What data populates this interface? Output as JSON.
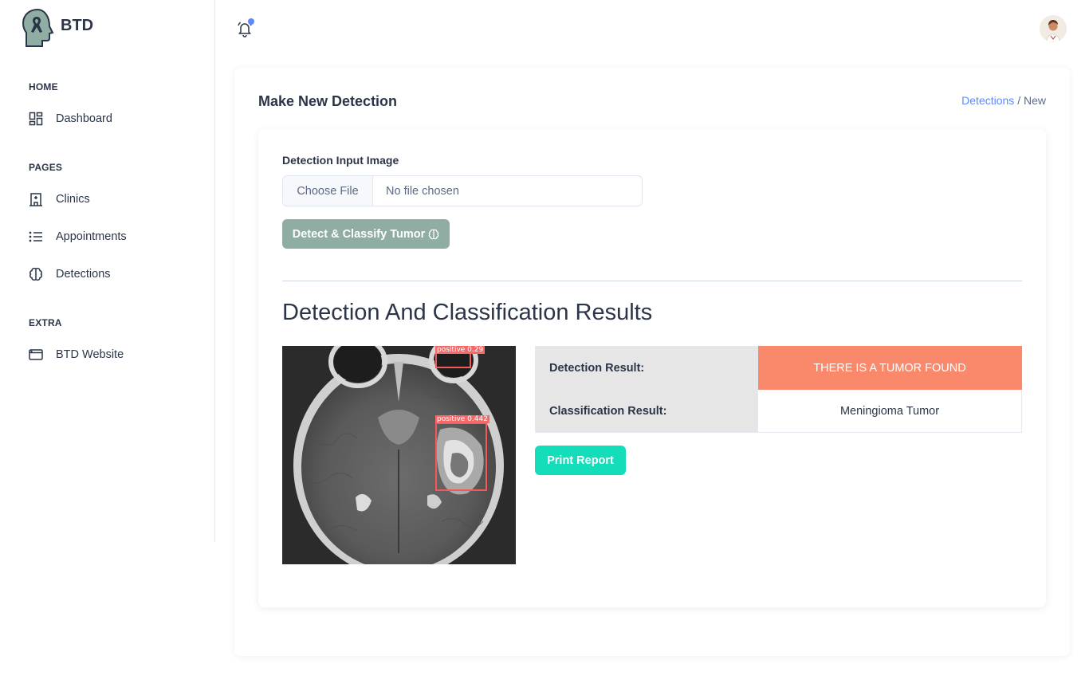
{
  "brand": {
    "name": "BTD",
    "logo_icon": "head-ribbon-logo"
  },
  "sidebar": {
    "sections": [
      {
        "title": "HOME",
        "items": [
          {
            "label": "Dashboard",
            "icon": "dashboard-icon"
          }
        ]
      },
      {
        "title": "PAGES",
        "items": [
          {
            "label": "Clinics",
            "icon": "building-icon"
          },
          {
            "label": "Appointments",
            "icon": "list-icon"
          },
          {
            "label": "Detections",
            "icon": "brain-icon"
          }
        ]
      },
      {
        "title": "EXTRA",
        "items": [
          {
            "label": "BTD Website",
            "icon": "browser-icon"
          }
        ]
      }
    ]
  },
  "header": {
    "notification_icon": "bell-icon",
    "notification_dot_color": "#5d87ff",
    "avatar": "user-avatar"
  },
  "page": {
    "title": "Make New Detection",
    "breadcrumb": {
      "link": "Detections",
      "separator": " / ",
      "current": "New"
    }
  },
  "form": {
    "label": "Detection Input Image",
    "file_button": "Choose File",
    "file_status": "No file chosen",
    "submit_label": "Detect & Classify Tumor",
    "submit_color": "#8fada3"
  },
  "results": {
    "title": "Detection And Classification Results",
    "image": {
      "boxes": [
        {
          "label": "positive  0.29"
        },
        {
          "label": "positive  0.442"
        }
      ]
    },
    "rows": [
      {
        "key": "Detection Result:",
        "value": "THERE IS A TUMOR FOUND",
        "color": "#fa896b"
      },
      {
        "key": "Classification Result:",
        "value": "Meningioma Tumor"
      }
    ],
    "print_label": "Print Report",
    "print_color": "#13deb9"
  }
}
